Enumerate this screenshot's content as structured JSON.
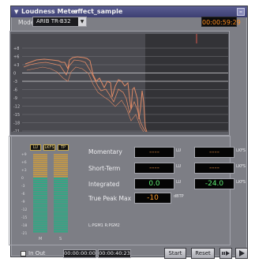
{
  "window": {
    "title": "Loudness Meter",
    "file_name": "effect_sample",
    "collapse_glyph": "▼",
    "minimize_glyph": "–"
  },
  "mode": {
    "label": "Mode",
    "selected": "ARIB TR-B32"
  },
  "timecode": "00:00:59:29",
  "graph": {
    "y_ticks": [
      "+8",
      "+6",
      "+3",
      "0",
      "-3",
      "-6",
      "-9",
      "-12",
      "-15",
      "-18",
      "-21"
    ],
    "series_color": "#e08a66",
    "cursor_color": "#d8584c",
    "highlighted_ticks": [
      "0",
      "-3"
    ]
  },
  "meters": {
    "tabs": [
      "LU",
      "LKFS",
      "TP"
    ],
    "scale": [
      "+9",
      "+6",
      "+3",
      "0",
      "-3",
      "-6",
      "-9",
      "-12",
      "-15",
      "-18",
      "-21"
    ],
    "channels": [
      "M",
      "S"
    ],
    "levels": [
      0.55,
      0.55
    ],
    "colors": {
      "over": "#c79a43",
      "normal": "#2bab84"
    }
  },
  "readings": {
    "momentary": {
      "label": "Momentary",
      "lu": "----",
      "lkfs": "----"
    },
    "short_term": {
      "label": "Short-Term",
      "lu": "----",
      "lkfs": "----"
    },
    "integrated": {
      "label": "Integrated",
      "lu": "0.0",
      "lkfs": "-24.0"
    },
    "true_peak": {
      "label": "True Peak Max",
      "value": "-10",
      "unit": "dBTP"
    },
    "units": {
      "lu": "LU",
      "lkfs": "LKFS"
    },
    "colors": {
      "dash": "#c47a3e",
      "integrated": "#5cea72",
      "peak": "#ff9d2a"
    }
  },
  "channel_info": "L:PGM1  R:PGM2",
  "footer": {
    "in_out_label": "In Out",
    "in_timecode": "00:00:00:00",
    "out_timecode": "00:00:40:23",
    "start_label": "Start",
    "reset_label": "Reset",
    "step_icon": "step-forward-icon",
    "play_icon": "play-icon"
  }
}
